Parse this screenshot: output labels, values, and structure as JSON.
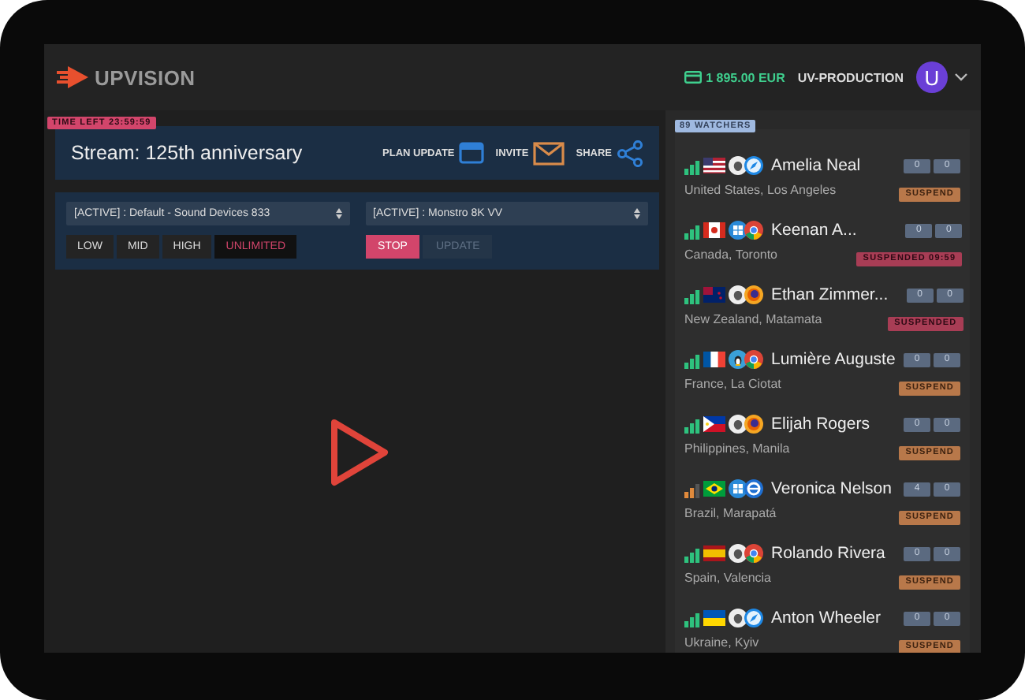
{
  "header": {
    "logo": "UPVISION",
    "balance": "1 895.00 EUR",
    "account": "UV-PRODUCTION",
    "avatar": "U"
  },
  "stream": {
    "time_left": "TIME LEFT 23:59:59",
    "title": "Stream: 125th anniversary",
    "actions": [
      {
        "label": "PLAN UPDATE",
        "kind": "calendar"
      },
      {
        "label": "INVITE",
        "kind": "mail"
      },
      {
        "label": "SHARE",
        "kind": "share"
      }
    ]
  },
  "controls": {
    "audio_source": "[ACTIVE] : Default - Sound Devices 833",
    "video_source": "[ACTIVE] : Monstro 8K VV",
    "quality": [
      {
        "label": "LOW",
        "selected": false
      },
      {
        "label": "MID",
        "selected": false
      },
      {
        "label": "HIGH",
        "selected": false
      },
      {
        "label": "UNLIMITED",
        "selected": true
      }
    ],
    "buttons": [
      {
        "label": "STOP",
        "disabled": false
      },
      {
        "label": "UPDATE",
        "disabled": true
      }
    ]
  },
  "watchers": {
    "count": "89 WATCHERS",
    "items": [
      {
        "name": "Amelia Neal",
        "location": "United States, Los Angeles",
        "signal": {
          "kind": "good"
        },
        "flag": {
          "kind": "us"
        },
        "os": {
          "kind": "apple"
        },
        "browser": {
          "kind": "safari"
        },
        "counters": [
          "0",
          "0"
        ],
        "status": {
          "kind": "action",
          "label": "SUSPEND"
        }
      },
      {
        "name": "Keenan A...",
        "location": "Canada, Toronto",
        "signal": {
          "kind": "good"
        },
        "flag": {
          "kind": "ca"
        },
        "os": {
          "kind": "windows"
        },
        "browser": {
          "kind": "chrome"
        },
        "counters": [
          "0",
          "0"
        ],
        "status": {
          "kind": "suspended",
          "label": "SUSPENDED 09:59"
        }
      },
      {
        "name": "Ethan Zimmer...",
        "location": "New Zealand, Matamata",
        "signal": {
          "kind": "good"
        },
        "flag": {
          "kind": "nz"
        },
        "os": {
          "kind": "apple"
        },
        "browser": {
          "kind": "firefox"
        },
        "counters": [
          "0",
          "0"
        ],
        "status": {
          "kind": "suspended",
          "label": "SUSPENDED"
        }
      },
      {
        "name": "Lumière Auguste",
        "location": "France, La Ciotat",
        "signal": {
          "kind": "good"
        },
        "flag": {
          "kind": "fr"
        },
        "os": {
          "kind": "linux"
        },
        "browser": {
          "kind": "chrome"
        },
        "counters": [
          "0",
          "0"
        ],
        "status": {
          "kind": "action",
          "label": "SUSPEND"
        }
      },
      {
        "name": "Elijah Rogers",
        "location": "Philippines, Manila",
        "signal": {
          "kind": "good"
        },
        "flag": {
          "kind": "ph"
        },
        "os": {
          "kind": "apple"
        },
        "browser": {
          "kind": "firefox"
        },
        "counters": [
          "0",
          "0"
        ],
        "status": {
          "kind": "action",
          "label": "SUSPEND"
        }
      },
      {
        "name": "Veronica Nelson",
        "location": "Brazil, Marapatá",
        "signal": {
          "kind": "weak"
        },
        "flag": {
          "kind": "br"
        },
        "os": {
          "kind": "windows"
        },
        "browser": {
          "kind": "ie"
        },
        "counters": [
          "4",
          "0"
        ],
        "status": {
          "kind": "action",
          "label": "SUSPEND"
        }
      },
      {
        "name": "Rolando Rivera",
        "location": "Spain, Valencia",
        "signal": {
          "kind": "good"
        },
        "flag": {
          "kind": "es"
        },
        "os": {
          "kind": "apple"
        },
        "browser": {
          "kind": "chrome"
        },
        "counters": [
          "0",
          "0"
        ],
        "status": {
          "kind": "action",
          "label": "SUSPEND"
        }
      },
      {
        "name": "Anton Wheeler",
        "location": "Ukraine, Kyiv",
        "signal": {
          "kind": "good"
        },
        "flag": {
          "kind": "ua"
        },
        "os": {
          "kind": "apple"
        },
        "browser": {
          "kind": "safari"
        },
        "counters": [
          "0",
          "0"
        ],
        "status": {
          "kind": "action",
          "label": "SUSPEND"
        }
      }
    ]
  }
}
